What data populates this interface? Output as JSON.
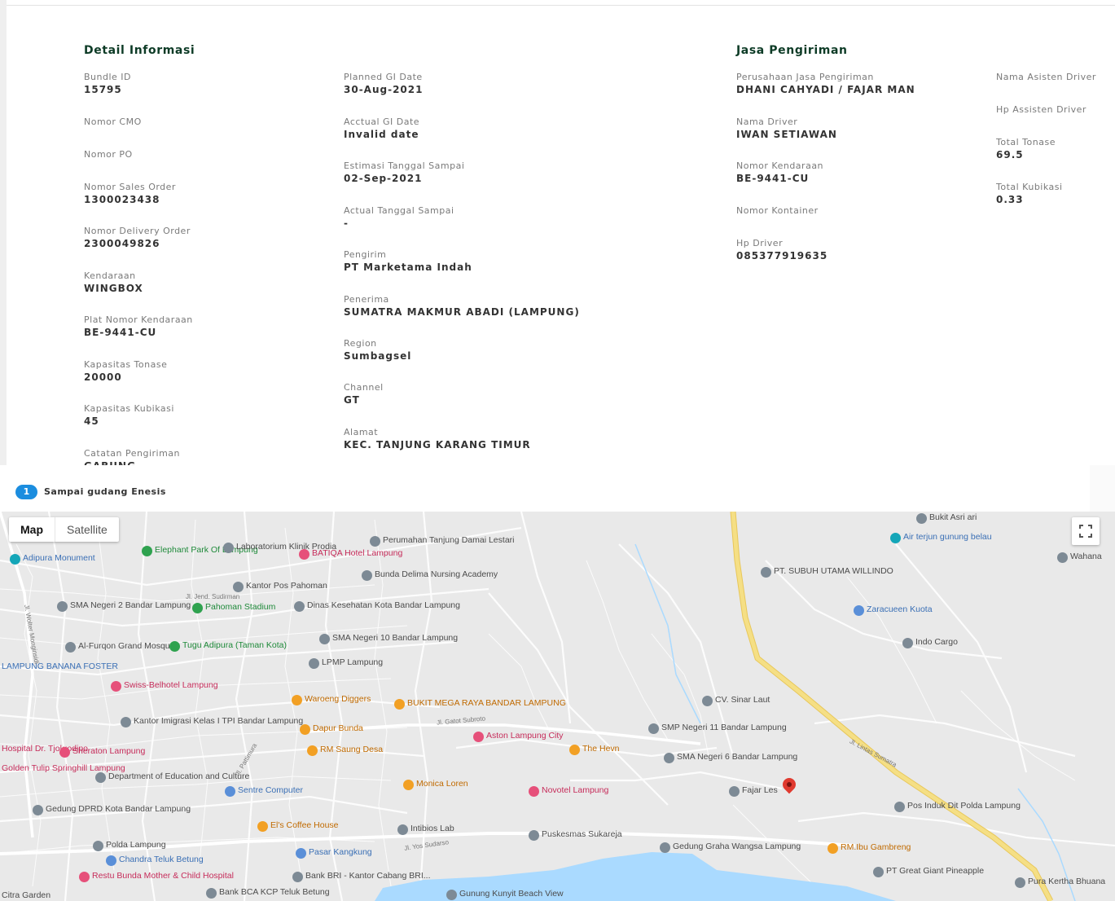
{
  "detail": {
    "title": "Detail Informasi",
    "col1": [
      {
        "label": "Bundle ID",
        "value": "15795"
      },
      {
        "label": "Nomor CMO",
        "value": ""
      },
      {
        "label": "Nomor PO",
        "value": ""
      },
      {
        "label": "Nomor Sales Order",
        "value": "1300023438"
      },
      {
        "label": "Nomor Delivery Order",
        "value": "2300049826"
      },
      {
        "label": "Kendaraan",
        "value": "WINGBOX"
      },
      {
        "label": "Plat Nomor Kendaraan",
        "value": "BE-9441-CU"
      },
      {
        "label": "Kapasitas Tonase",
        "value": "20000"
      },
      {
        "label": "Kapasitas Kubikasi",
        "value": "45"
      },
      {
        "label": "Catatan Pengiriman",
        "value": "GABUNG"
      }
    ],
    "col2": [
      {
        "label": "Planned GI Date",
        "value": "30-Aug-2021"
      },
      {
        "label": "Acctual GI Date",
        "value": "Invalid date"
      },
      {
        "label": "Estimasi Tanggal Sampai",
        "value": "02-Sep-2021"
      },
      {
        "label": "Actual Tanggal Sampai",
        "value": "-"
      },
      {
        "label": "Pengirim",
        "value": "PT Marketama Indah"
      },
      {
        "label": "Penerima",
        "value": "SUMATRA MAKMUR ABADI (LAMPUNG)"
      },
      {
        "label": "Region",
        "value": "Sumbagsel"
      },
      {
        "label": "Channel",
        "value": "GT"
      },
      {
        "label": "Alamat",
        "value": "KEC. TANJUNG KARANG TIMUR"
      }
    ]
  },
  "jasa": {
    "title": "Jasa Pengiriman",
    "col1": [
      {
        "label": "Perusahaan Jasa Pengiriman",
        "value": "DHANI CAHYADI / FAJAR MAN"
      },
      {
        "label": "Nama Driver",
        "value": "IWAN SETIAWAN"
      },
      {
        "label": "Nomor Kendaraan",
        "value": "BE-9441-CU"
      },
      {
        "label": "Nomor Kontainer",
        "value": ""
      },
      {
        "label": "Hp Driver",
        "value": "085377919635"
      }
    ],
    "col2": [
      {
        "label": "Nama Asisten Driver",
        "value": ""
      },
      {
        "label": "Hp Assisten Driver",
        "value": ""
      },
      {
        "label": "Total Tonase",
        "value": "69.5"
      },
      {
        "label": "Total Kubikasi",
        "value": "0.33"
      }
    ]
  },
  "steps": [
    {
      "number": "1",
      "label": "Sampai gudang Enesis"
    }
  ],
  "map": {
    "type_map": "Map",
    "type_satellite": "Satellite",
    "water_color": "#aadaff",
    "marker_color": "#e03a2f",
    "roads_main": "#f2dc7d",
    "places": [
      {
        "name": "Adipura Monument",
        "kind": "teal",
        "text": "blue"
      },
      {
        "name": "Elephant Park Of Lampung",
        "kind": "grn",
        "text": "grn"
      },
      {
        "name": "Laboratorium Klinik Prodia",
        "kind": "g",
        "text": "g"
      },
      {
        "name": "BATIQA Hotel Lampung",
        "kind": "red",
        "text": "red"
      },
      {
        "name": "Perumahan Tanjung Damai Lestari",
        "kind": "g",
        "text": "g"
      },
      {
        "name": "Kantor Pos Pahoman",
        "kind": "g",
        "text": "g"
      },
      {
        "name": "Bunda Delima Nursing Academy",
        "kind": "g",
        "text": "g"
      },
      {
        "name": "SMA Negeri 2 Bandar Lampung",
        "kind": "g",
        "text": "g"
      },
      {
        "name": "Pahoman Stadium",
        "kind": "grn",
        "text": "grn"
      },
      {
        "name": "Dinas Kesehatan Kota Bandar Lampung",
        "kind": "g",
        "text": "g"
      },
      {
        "name": "SMA Negeri 10 Bandar Lampung",
        "kind": "g",
        "text": "g"
      },
      {
        "name": "Al-Furqon Grand Mosque",
        "kind": "g",
        "text": "g"
      },
      {
        "name": "Tugu Adipura (Taman Kota)",
        "kind": "grn",
        "text": "grn"
      },
      {
        "name": "LPMP Lampung",
        "kind": "g",
        "text": "g"
      },
      {
        "name": "LAMPUNG BANANA FOSTER",
        "kind": "blue",
        "text": "blue"
      },
      {
        "name": "Swiss-Belhotel Lampung",
        "kind": "red",
        "text": "red"
      },
      {
        "name": "Waroeng Diggers",
        "kind": "org",
        "text": "org"
      },
      {
        "name": "BUKIT MEGA RAYA BANDAR LAMPUNG",
        "kind": "org",
        "text": "org"
      },
      {
        "name": "Kantor Imigrasi Kelas I TPI Bandar Lampung",
        "kind": "g",
        "text": "g"
      },
      {
        "name": "Dapur Bunda",
        "kind": "org",
        "text": "org"
      },
      {
        "name": "Aston Lampung City",
        "kind": "red",
        "text": "red"
      },
      {
        "name": "The Hevn",
        "kind": "org",
        "text": "org"
      },
      {
        "name": "Hospital Dr. Tjokrodipo",
        "kind": "red",
        "text": "red"
      },
      {
        "name": "Sheraton Lampung",
        "kind": "red",
        "text": "red"
      },
      {
        "name": "RM Saung Desa",
        "kind": "org",
        "text": "org"
      },
      {
        "name": "Golden Tulip Springhill Lampung",
        "kind": "red",
        "text": "red"
      },
      {
        "name": "Department of Education and Culture",
        "kind": "g",
        "text": "g"
      },
      {
        "name": "Sentre Computer",
        "kind": "blue",
        "text": "blue"
      },
      {
        "name": "Monica Loren",
        "kind": "org",
        "text": "org"
      },
      {
        "name": "Novotel Lampung",
        "kind": "red",
        "text": "red"
      },
      {
        "name": "Gedung DPRD Kota Bandar Lampung",
        "kind": "g",
        "text": "g"
      },
      {
        "name": "El's Coffee House",
        "kind": "org",
        "text": "org"
      },
      {
        "name": "Intibios Lab",
        "kind": "g",
        "text": "g"
      },
      {
        "name": "Puskesmas Sukareja",
        "kind": "g",
        "text": "g"
      },
      {
        "name": "Polda Lampung",
        "kind": "g",
        "text": "g"
      },
      {
        "name": "Pasar Kangkung",
        "kind": "blue",
        "text": "blue"
      },
      {
        "name": "Gedung Graha Wangsa Lampung",
        "kind": "g",
        "text": "g"
      },
      {
        "name": "Chandra Teluk Betung",
        "kind": "blue",
        "text": "blue"
      },
      {
        "name": "Restu Bunda Mother & Child Hospital",
        "kind": "red",
        "text": "red"
      },
      {
        "name": "Bank BRI - Kantor Cabang BRI...",
        "kind": "g",
        "text": "g"
      },
      {
        "name": "Citra Garden",
        "kind": "g",
        "text": "g"
      },
      {
        "name": "Bank BCA KCP Teluk Betung",
        "kind": "g",
        "text": "g"
      },
      {
        "name": "Gunung Kunyit Beach View",
        "kind": "g",
        "text": "g"
      },
      {
        "name": "Bukit Asri ari",
        "kind": "g",
        "text": "g"
      },
      {
        "name": "Air terjun gunung belau",
        "kind": "teal",
        "text": "blue"
      },
      {
        "name": "Wahana",
        "kind": "g",
        "text": "g"
      },
      {
        "name": "PT. SUBUH UTAMA WILLINDO",
        "kind": "g",
        "text": "g"
      },
      {
        "name": "Zaracueen Kuota",
        "kind": "blue",
        "text": "blue"
      },
      {
        "name": "Indo Cargo",
        "kind": "g",
        "text": "g"
      },
      {
        "name": "CV. Sinar Laut",
        "kind": "g",
        "text": "g"
      },
      {
        "name": "SMP Negeri 11 Bandar Lampung",
        "kind": "g",
        "text": "g"
      },
      {
        "name": "SMA Negeri 6 Bandar Lampung",
        "kind": "g",
        "text": "g"
      },
      {
        "name": "Fajar Les",
        "kind": "g",
        "text": "g"
      },
      {
        "name": "Pos Induk Dit Polda Lampung",
        "kind": "g",
        "text": "g"
      },
      {
        "name": "RM.Ibu Gambreng",
        "kind": "org",
        "text": "org"
      },
      {
        "name": "PT Great Giant Pineapple",
        "kind": "g",
        "text": "g"
      },
      {
        "name": "Pura Kertha Bhuana",
        "kind": "g",
        "text": "g"
      }
    ],
    "roads": [
      "Jl. Lintas Sumatra",
      "Jl. Gatot Subroto",
      "Jl. Yos Sudarso",
      "Jl. Jend. Sudirman",
      "Jl. Wolter Monginsidi",
      "Jl. Pattimura"
    ]
  }
}
